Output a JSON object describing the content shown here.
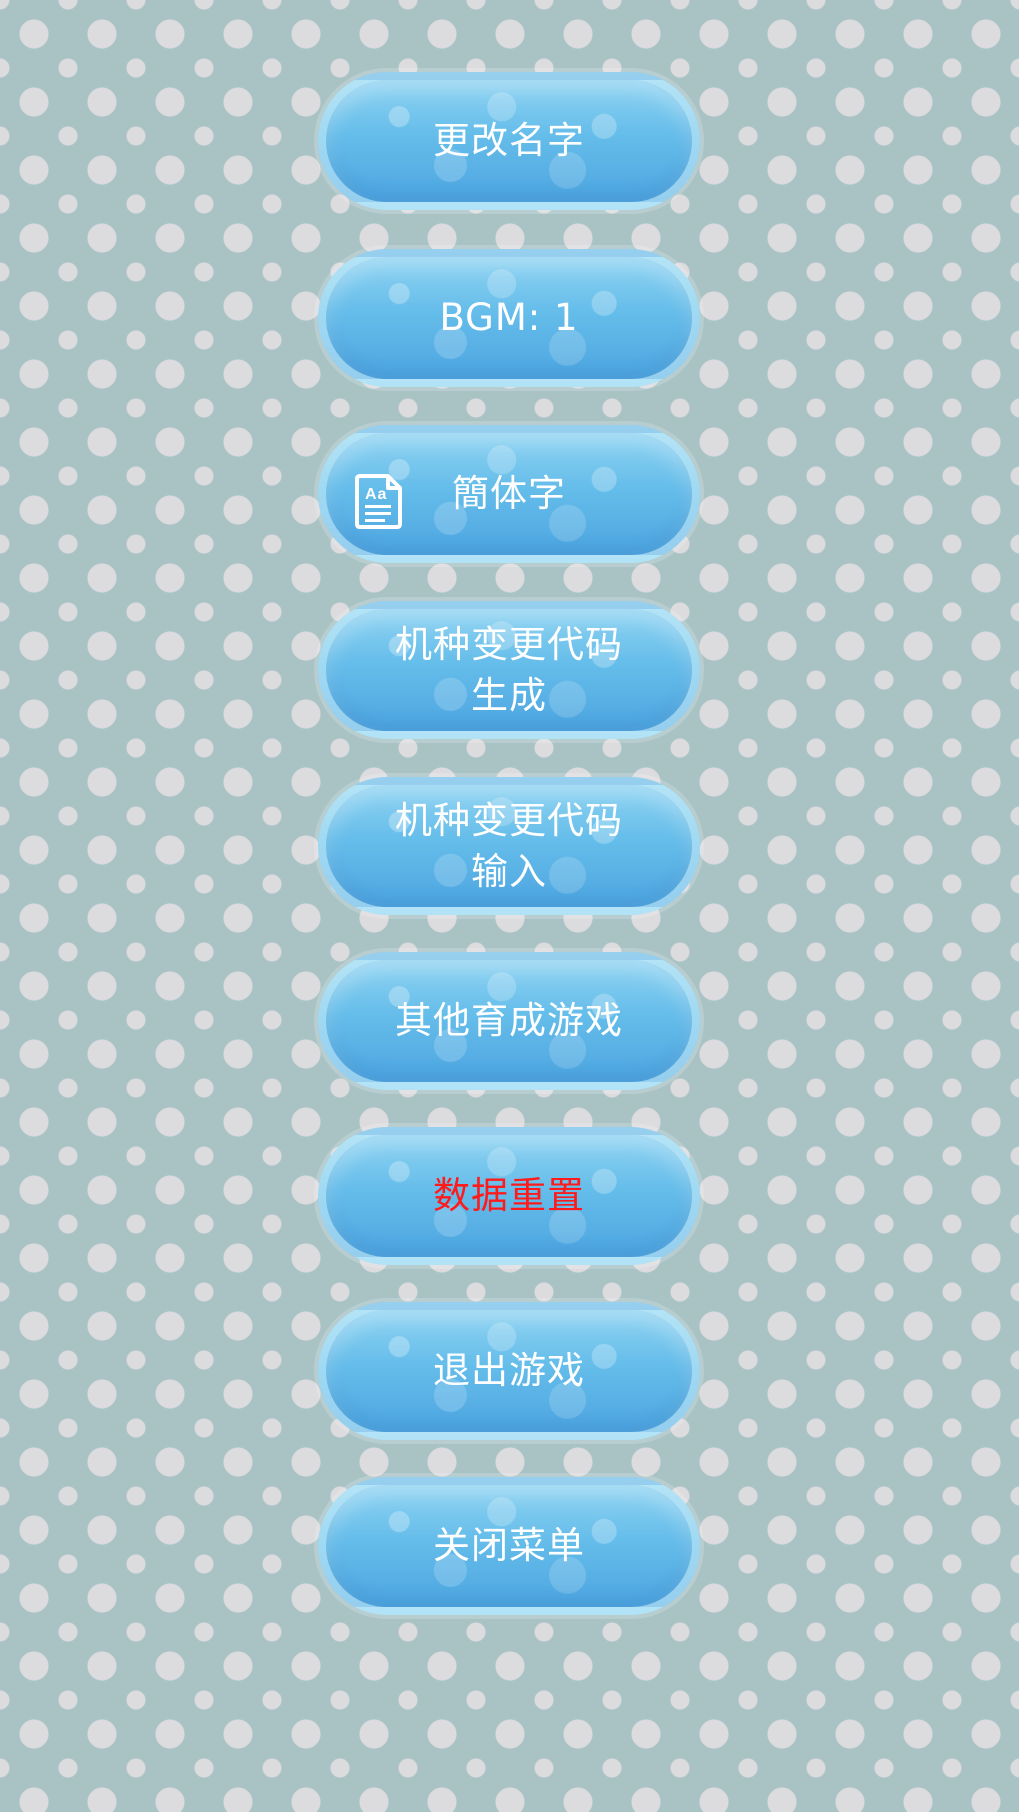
{
  "menu": {
    "buttons": [
      {
        "label": "更改名字"
      },
      {
        "label": "BGM: 1"
      },
      {
        "label": "簡体字",
        "icon": "font-document-icon"
      },
      {
        "label": "机种变更代码\n生成"
      },
      {
        "label": "机种变更代码\n输入"
      },
      {
        "label": "其他育成游戏"
      },
      {
        "label": "数据重置",
        "color": "#ff1b1b"
      },
      {
        "label": "退出游戏"
      },
      {
        "label": "关闭菜单"
      }
    ]
  },
  "colors": {
    "background": "#a9c3c5",
    "dot": "#dcdcdf",
    "button_top": "#8fd3f2",
    "button_bottom": "#4da5e1",
    "text": "#ffffff",
    "danger_text": "#ff1b1b"
  }
}
